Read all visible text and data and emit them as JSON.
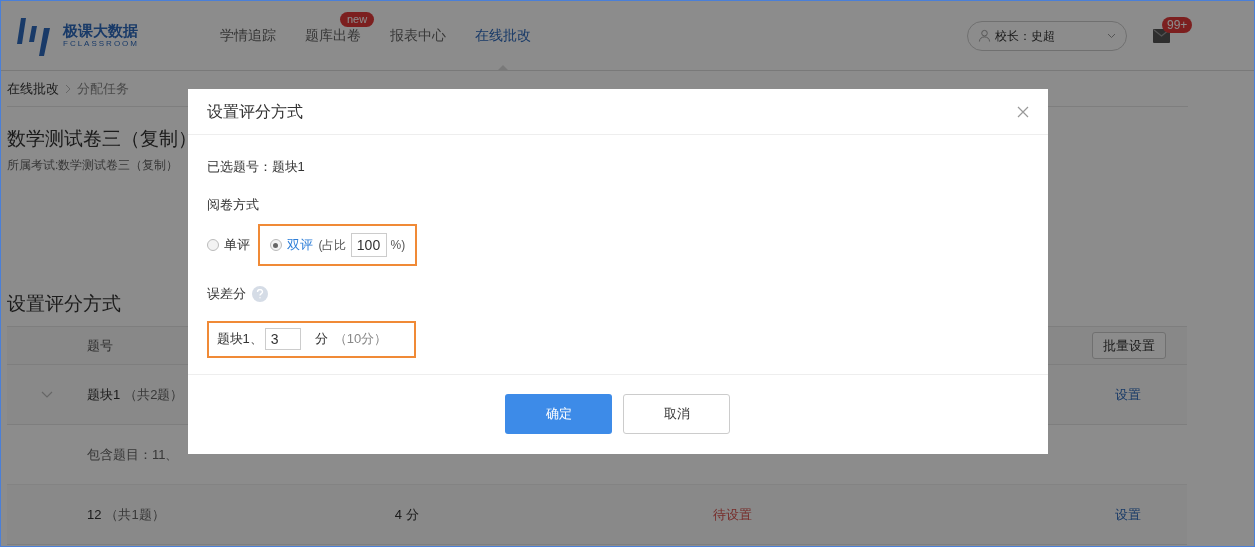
{
  "header": {
    "logo": {
      "title": "极课大数据",
      "subtitle": "FCLASSROOM"
    },
    "nav": [
      {
        "label": "学情追踪",
        "selected": false
      },
      {
        "label": "题库出卷",
        "selected": false,
        "badge": "new"
      },
      {
        "label": "报表中心",
        "selected": false
      },
      {
        "label": "在线批改",
        "selected": true
      }
    ],
    "user_menu": "校长：史超",
    "mail_badge": "99+"
  },
  "breadcrumb": [
    "在线批改",
    "分配任务"
  ],
  "exam": {
    "title": "数学测试卷三（复制）",
    "subtitle": "所属考试:数学测试卷三（复制）"
  },
  "section_title": "设置评分方式",
  "table": {
    "columns": [
      "题号"
    ],
    "batch_button": "批量设置",
    "rows": [
      {
        "kind": "group",
        "expanded": true,
        "name": "题块1",
        "count": "（共2题）",
        "action": "设置"
      },
      {
        "kind": "detail",
        "text": "包含题目：11、"
      },
      {
        "kind": "item",
        "name": "12",
        "count": "（共1题）",
        "score": "4 分",
        "status": "待设置",
        "action": "设置"
      }
    ]
  },
  "modal": {
    "title": "设置评分方式",
    "selected_label": "已选题号：",
    "selected_value": "题块1",
    "mode_label": "阅卷方式",
    "options": [
      {
        "label": "单评",
        "selected": false
      },
      {
        "label": "双评",
        "selected": true,
        "ratio_prefix": "(占比",
        "ratio": "100",
        "ratio_suffix": "%)"
      }
    ],
    "error_label": "误差分",
    "error_rows": [
      {
        "label": "题块1、",
        "value": "3",
        "unit": "分",
        "note": "（10分）"
      }
    ],
    "buttons": [
      {
        "label": "确定",
        "kind": "primary"
      },
      {
        "label": "取消",
        "kind": "default"
      }
    ]
  }
}
